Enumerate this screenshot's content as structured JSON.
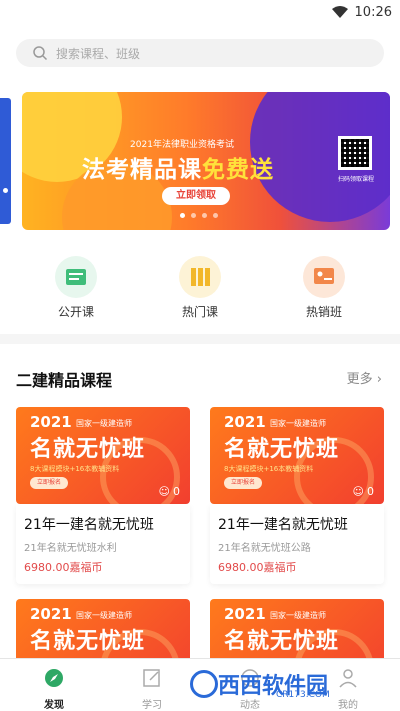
{
  "status_bar": {
    "time": "10:26"
  },
  "search": {
    "placeholder": "搜索课程、班级"
  },
  "banner": {
    "subtitle": "2021年法律职业资格考试",
    "headline_main": "法考精品课",
    "headline_highlight": "免费送",
    "cta": "立即领取",
    "qr_caption": "扫码领取课程",
    "slide_count": 4,
    "active_slide": 0
  },
  "quick_links": [
    {
      "label": "公开课",
      "icon": "open-class-icon",
      "color": "#3fbd7a"
    },
    {
      "label": "热门课",
      "icon": "hot-course-icon",
      "color": "#f2b72a"
    },
    {
      "label": "热销班",
      "icon": "bestseller-class-icon",
      "color": "#f2874a"
    }
  ],
  "section": {
    "title": "二建精品课程",
    "more": "更多"
  },
  "cards": [
    {
      "year": "2021",
      "kicker": "国家一级建造师",
      "big": "名就无忧班",
      "small": "8大课程模块+16本教辅资料",
      "btn": "立即报名",
      "viewers": "0",
      "name": "21年一建名就无忧班",
      "sub": "21年名就无忧班水利",
      "price": "6980.00嘉福币"
    },
    {
      "year": "2021",
      "kicker": "国家一级建造师",
      "big": "名就无忧班",
      "small": "8大课程模块+16本教辅资料",
      "btn": "立即报名",
      "viewers": "0",
      "name": "21年一建名就无忧班",
      "sub": "21年名就无忧班公路",
      "price": "6980.00嘉福币"
    },
    {
      "year": "2021",
      "kicker": "国家一级建造师",
      "big": "名就无忧班"
    },
    {
      "year": "2021",
      "kicker": "国家一级建造师",
      "big": "名就无忧班"
    }
  ],
  "tabbar": [
    {
      "label": "发现",
      "active": true
    },
    {
      "label": "学习",
      "active": false
    },
    {
      "label": "动态",
      "active": false
    },
    {
      "label": "我的",
      "active": false
    }
  ],
  "watermark": {
    "brand": "西西软件园",
    "url": "CR173.COM"
  },
  "colors": {
    "accent": "#2ea865",
    "price": "#e24b4b",
    "banner_purple": "#7a3bd8"
  }
}
